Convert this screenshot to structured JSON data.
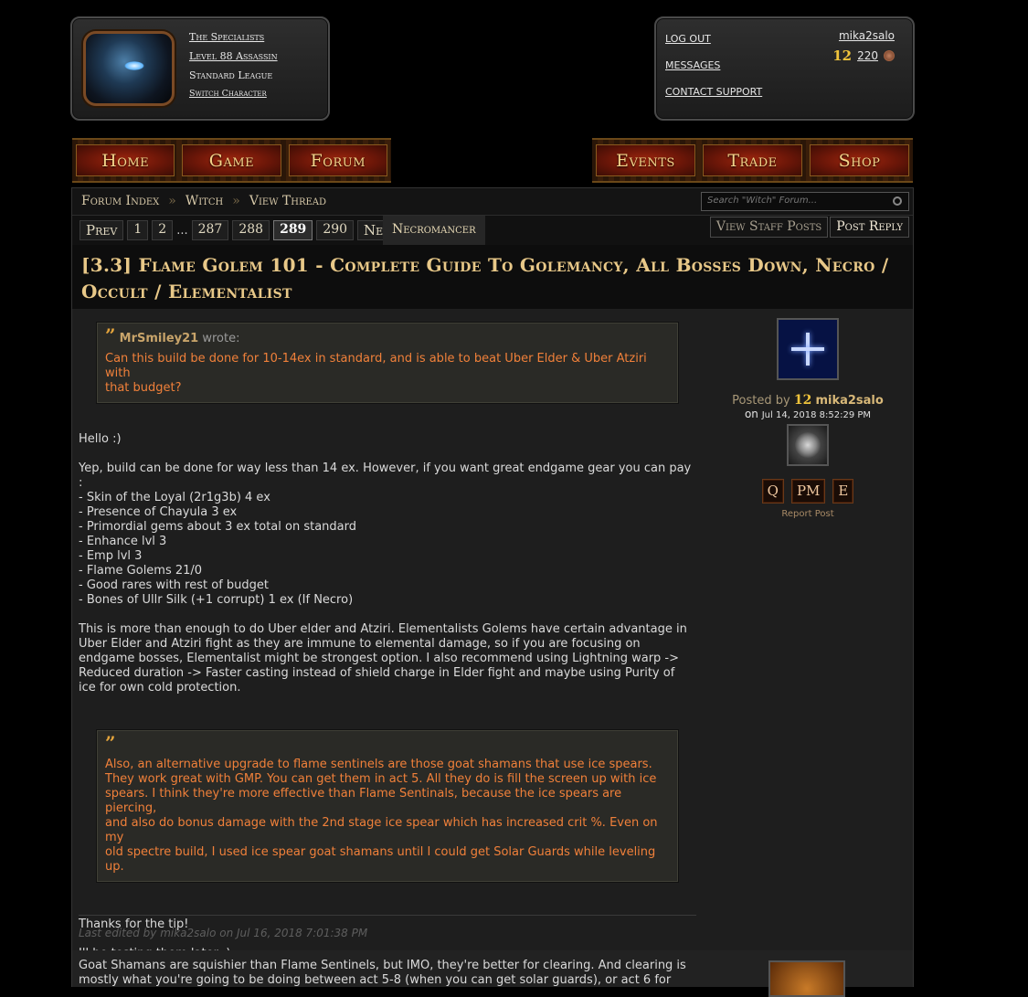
{
  "character": {
    "guild": "The Specialists",
    "level_class": "Level 88 Assassin",
    "league": "Standard League",
    "switch": "Switch Character"
  },
  "account": {
    "logout": "LOG OUT",
    "messages": "MESSAGES",
    "contact": "CONTACT SUPPORT",
    "username": "mika2salo",
    "level_badge": "12",
    "points": "220"
  },
  "nav_left": [
    "Home",
    "Game",
    "Forum"
  ],
  "nav_right": [
    "Events",
    "Trade",
    "Shop"
  ],
  "breadcrumb": {
    "items": [
      "Forum Index",
      "Witch",
      "View Thread"
    ],
    "separator": "»"
  },
  "search": {
    "placeholder": "Search \"Witch\" Forum..."
  },
  "pager": {
    "prev": "Prev",
    "p1": "1",
    "p2": "2",
    "dots": "...",
    "p287": "287",
    "p288": "288",
    "p289": "289",
    "p290": "290",
    "next": "Next"
  },
  "thread_tag": "Necromancer",
  "buttons": {
    "staff": "View Staff Posts",
    "reply": "Post Reply"
  },
  "thread_title": "[3.3] Flame Golem 101 - Complete Guide To Golemancy, All Bosses Down, Necro / Occult / Elementalist",
  "post": {
    "quote1": {
      "mark": "”",
      "author": "MrSmiley21",
      "wrote": "wrote:",
      "text": "Can this build be done for 10-14ex in standard, and is able to beat Uber Elder & Uber Atziri with\nthat budget?"
    },
    "para1": "Hello :)\n\nYep, build can be done for way less than 14 ex. However, if you want great endgame gear you can pay\n:\n- Skin of the Loyal (2r1g3b) 4 ex\n- Presence of Chayula 3 ex\n- Primordial gems about 3 ex total on standard\n- Enhance lvl 3\n- Emp lvl 3\n- Flame Golems 21/0\n- Good rares with rest of budget\n- Bones of Ullr Silk (+1 corrupt) 1 ex (If Necro)\n\nThis is more than enough to do Uber elder and Atziri. Elementalists Golems have certain advantage in\nUber Elder and Atziri fight as they are immune to elemental damage, so if you are focusing on\nendgame bosses, Elementalist might be strongest option. I also recommend using Lightning warp ->\nReduced duration -> Faster casting instead of shield charge in Elder fight and maybe using Purity of\nice for own cold protection.",
    "quote2": {
      "mark": "”",
      "text": "Also, an alternative upgrade to flame sentinels are those goat shamans that use ice spears.\nThey work great with GMP. You can get them in act 5. All they do is fill the screen up with ice\nspears. I think they're more effective than Flame Sentinals, because the ice spears are piercing,\nand also do bonus damage with the 2nd stage ice spear which has increased crit %. Even on my\nold spectre build, I used ice spear goat shamans until I could get Solar Guards while leveling up."
    },
    "para2": "Thanks for the tip!\n\nIll be testing them later :)",
    "edited": "Last edited by mika2salo on Jul 16, 2018 7:01:38 PM",
    "posted_by": "Posted by",
    "author": "mika2salo",
    "author_level": "12",
    "on": "on",
    "date": "Jul 14, 2018 8:52:29 PM",
    "actions": [
      "Q",
      "PM",
      "E"
    ],
    "report": "Report Post"
  },
  "post2": {
    "text": "Goat Shamans are squishier than Flame Sentinels, but IMO, they're better for clearing. And clearing is\nmostly what you're going to be doing between act 5-8 (when you can get solar guards), or act 6 for"
  },
  "colors": {
    "quote_text": "#f0803a",
    "title": "#e8c888",
    "nav_text": "#f4d58a"
  }
}
